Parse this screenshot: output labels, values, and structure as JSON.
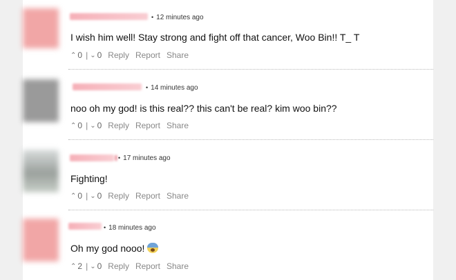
{
  "comments": [
    {
      "timestamp": "12 minutes ago",
      "text": "I wish him well! Stay strong and fight off that cancer, Woo Bin!! T_ T",
      "upvotes": "0",
      "downvotes": "0",
      "reply_label": "Reply",
      "report_label": "Report",
      "share_label": "Share"
    },
    {
      "timestamp": "14 minutes ago",
      "text": "noo oh my god! is this real?? this can't be real? kim woo bin??",
      "upvotes": "0",
      "downvotes": "0",
      "reply_label": "Reply",
      "report_label": "Report",
      "share_label": "Share"
    },
    {
      "timestamp": "17 minutes ago",
      "text": "Fighting!",
      "upvotes": "0",
      "downvotes": "0",
      "reply_label": "Reply",
      "report_label": "Report",
      "share_label": "Share"
    },
    {
      "timestamp": "18 minutes ago",
      "text": "Oh my god nooo!",
      "emoji": "screaming-face-emoji",
      "upvotes": "2",
      "downvotes": "0",
      "reply_label": "Reply",
      "report_label": "Report",
      "share_label": "Share"
    }
  ],
  "icons": {
    "upvote": "caret-up-icon",
    "downvote": "caret-down-icon"
  }
}
